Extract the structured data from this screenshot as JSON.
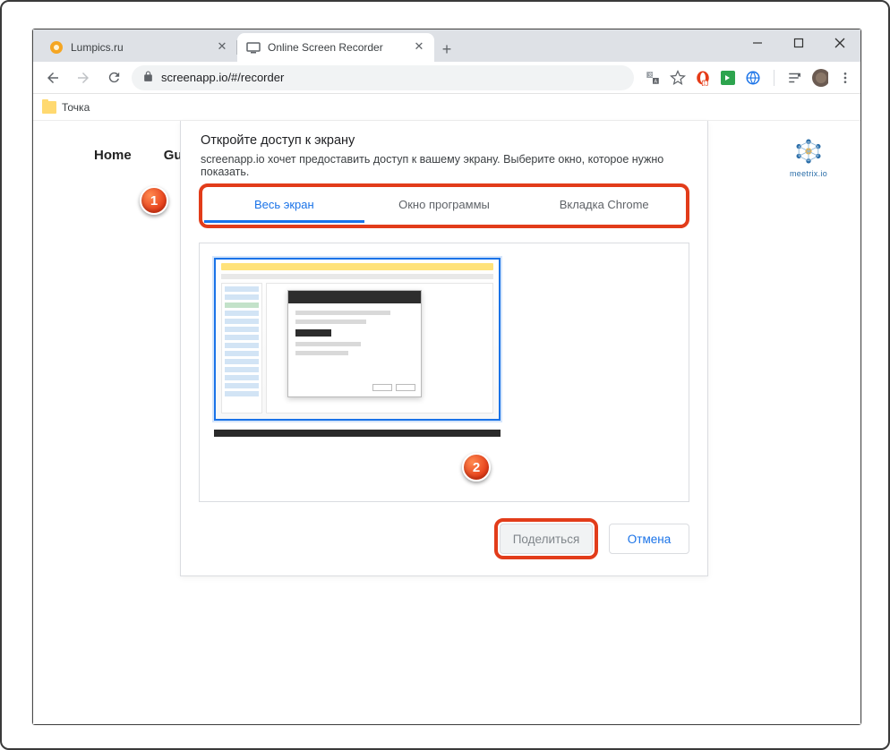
{
  "tabs": [
    {
      "title": "Lumpics.ru",
      "active": false
    },
    {
      "title": "Online Screen Recorder",
      "active": true
    }
  ],
  "address_bar": {
    "url": "screenapp.io/#/recorder"
  },
  "bookmarks": {
    "folder1": "Точка"
  },
  "page_nav": {
    "item1": "Home",
    "item2": "Gu"
  },
  "brand": {
    "text": "meetrix.io"
  },
  "dialog": {
    "title": "Откройте доступ к экрану",
    "subtitle": "screenapp.io хочет предоставить доступ к вашему экрану. Выберите окно, которое нужно показать.",
    "tabs": {
      "entire_screen": "Весь экран",
      "app_window": "Окно программы",
      "chrome_tab": "Вкладка Chrome"
    },
    "buttons": {
      "share": "Поделиться",
      "cancel": "Отмена"
    }
  },
  "markers": {
    "m1": "1",
    "m2": "2"
  }
}
